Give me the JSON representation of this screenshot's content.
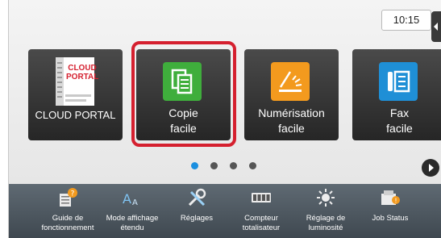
{
  "status": {
    "time": "10:15"
  },
  "tiles": [
    {
      "name": "cloud-portal",
      "logo_line1": "CLOUD",
      "logo_line2": "PORTAL",
      "label": "CLOUD PORTAL"
    },
    {
      "name": "copie-facile",
      "line1": "Copie",
      "line2": "facile",
      "selected": true
    },
    {
      "name": "numerisation-facile",
      "line1": "Numérisation",
      "line2": "facile"
    },
    {
      "name": "fax-facile",
      "line1": "Fax",
      "line2": "facile"
    }
  ],
  "pagination": {
    "pages": 4,
    "current": 1
  },
  "bottom_bar": [
    {
      "line1": "Guide de",
      "line2": "fonctionnement",
      "icon": "guide-icon"
    },
    {
      "line1": "Mode affichage",
      "line2": "étendu",
      "icon": "zoom-text-icon"
    },
    {
      "line1": "Réglages",
      "line2": "",
      "icon": "tools-icon"
    },
    {
      "line1": "Compteur",
      "line2": "totalisateur",
      "icon": "counter-icon"
    },
    {
      "line1": "Réglage de",
      "line2": "luminosité",
      "icon": "brightness-icon"
    },
    {
      "line1": "Job Status",
      "line2": "",
      "icon": "job-status-icon"
    }
  ],
  "colors": {
    "highlight": "#d5202f",
    "copy_green": "#3fae3c",
    "scan_orange": "#f39a1e",
    "fax_blue": "#1f8fd6",
    "dot_active": "#1a8fe0"
  }
}
